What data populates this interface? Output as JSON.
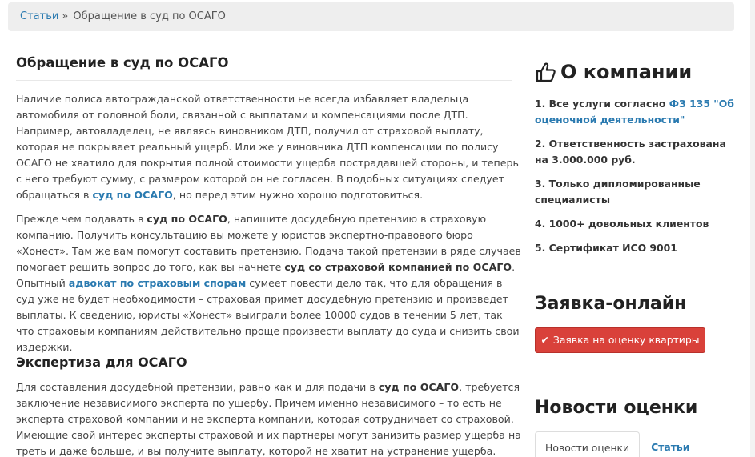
{
  "breadcrumb": {
    "parent": "Статьи",
    "separator": "»",
    "current": "Обращение в суд по ОСАГО"
  },
  "article": {
    "title": "Обращение в суд по ОСАГО",
    "p1": {
      "t1": "Наличие полиса автогражданской ответственности не всегда избавляет владельца автомобиля от головной боли, связанной с выплатами и компенсациями после ДТП. Например, автовладелец, не являясь виновником ДТП, получил от страховой выплату, которая не покрывает реальный ущерб. Или же у виновника ДТП компенсации по полису ОСАГО не хватило для покрытия полной стоимости ущерба пострадавшей стороны, и теперь с него требуют сумму, с размером которой он не согласен. В подобных ситуациях следует обращаться в ",
      "link": "суд по ОСАГО",
      "t2": ", но перед этим нужно хорошо подготовиться."
    },
    "p2": {
      "t1": "Прежде чем подавать в ",
      "b1": "суд по ОСАГО",
      "t2": ", напишите досудебную претензию в страховую компанию. Получить консультацию вы можете у юристов экспертно-правового бюро «Хонест». Там же вам помогут составить претензию. Подача такой претензии в ряде случаев помогает решить вопрос до того, как вы начнете ",
      "b2": "суд со страховой компанией по ОСАГО",
      "t3": ". Опытный ",
      "link": "адвокат по страховым спорам",
      "t4": " сумеет повести дело так, что для обращения в суд уже не будет необходимости – страховая примет досудебную претензию и произведет выплаты. К сведению, юристы «Хонест» выиграли более 10000 судов в течении 5 лет, так что страховым компаниям действительно проще произвести выплату до суда и снизить свои издержки."
    },
    "h2": "Экспертиза для ОСАГО",
    "p3": {
      "t1": "Для составления досудебной претензии, равно как и для подачи в ",
      "b1": "суд по ОСАГО",
      "t2": ", требуется заключение независимого эксперта по ущербу. Причем именно независимого – то есть не эксперта страховой компании и не эксперта компании, которая сотрудничает со страховой. Имеющие свой интерес эксперты страховой и их партнеры могут занизить размер ущерба на треть и даже больше, и вы получите выплату, которой не хватит на устранение ущерба."
    }
  },
  "sidebar": {
    "about_title": "О компании",
    "about_items": [
      {
        "text": "1. Все услуги согласно ",
        "link": "ФЗ 135 \"Об оценочной деятельности\""
      },
      {
        "text": "2. Ответственность застрахована на 3.000.000 руб."
      },
      {
        "text": "3. Только дипломированные специалисты"
      },
      {
        "text": "4. 1000+ довольных клиентов"
      },
      {
        "text": "5. Сертификат ИСО 9001"
      }
    ],
    "request_title": "Заявка-онлайн",
    "request_button": "Заявка на оценку квартиры",
    "news_title": "Новости оценки",
    "tabs": [
      "Новости оценки",
      "Статьи"
    ]
  },
  "colors": {
    "link": "#2a7ab0",
    "button": "#d9413a",
    "breadcrumb_bg": "#eeeeee"
  },
  "icons": {
    "about": "thumbs-up-icon",
    "button": "check-icon"
  }
}
